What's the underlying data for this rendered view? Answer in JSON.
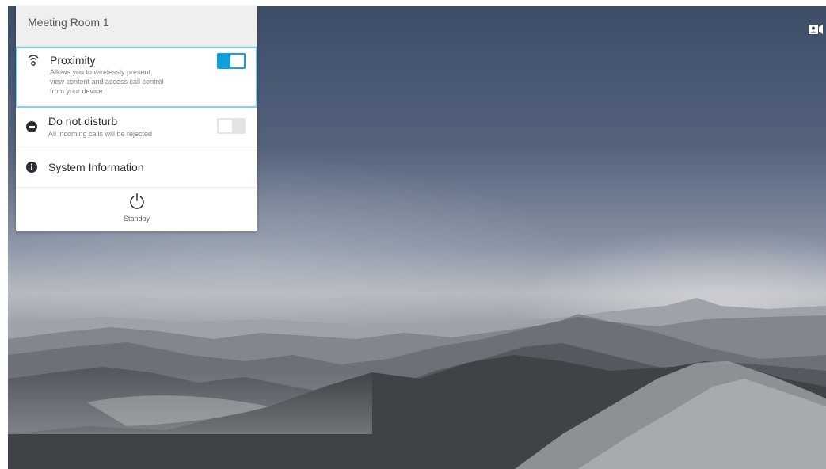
{
  "header": {
    "title": "Meeting Room 1"
  },
  "proximity": {
    "title": "Proximity",
    "description_lines": [
      "Allows you to wirelessly present,",
      "view content and access call control",
      "from your device"
    ],
    "enabled": true,
    "icon": "proximity-icon"
  },
  "do_not_disturb": {
    "title": "Do not disturb",
    "description": "All incoming calls will be rejected",
    "enabled": false,
    "icon": "minus-circle-icon"
  },
  "system_information": {
    "title": "System Information",
    "icon": "info-circle-icon"
  },
  "standby": {
    "label": "Standby",
    "icon": "power-icon"
  },
  "colors": {
    "accent": "#0fa2da",
    "focus_border": "#7fd0ec"
  },
  "top_right_icon": "self-view-icon"
}
